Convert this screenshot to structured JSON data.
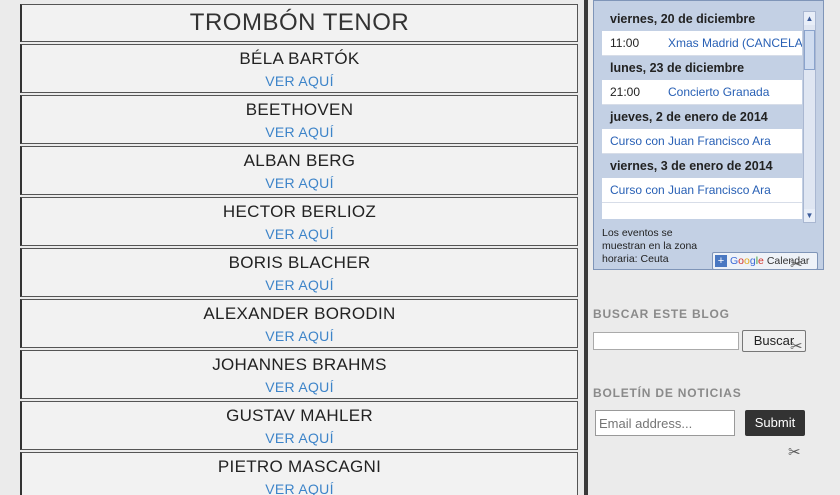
{
  "main": {
    "table_title": "TROMBÓN TENOR",
    "link_label": "VER AQUÍ",
    "composers": [
      "BÉLA BARTÓK",
      "BEETHOVEN",
      "ALBAN BERG",
      "HECTOR BERLIOZ",
      "BORIS BLACHER",
      "ALEXANDER BORODIN",
      "JOHANNES BRAHMS",
      "GUSTAV MAHLER",
      "PIETRO MASCAGNI"
    ]
  },
  "calendar": {
    "days": [
      {
        "date": "viernes, 20 de diciembre",
        "events": [
          {
            "time": "11:00",
            "title": "Xmas Madrid (CANCELADO)"
          }
        ]
      },
      {
        "date": "lunes, 23 de diciembre",
        "events": [
          {
            "time": "21:00",
            "title": "Concierto Granada"
          }
        ]
      },
      {
        "date": "jueves, 2 de enero de 2014",
        "events": [
          {
            "time": "",
            "title": "Curso con Juan Francisco Ara"
          }
        ]
      },
      {
        "date": "viernes, 3 de enero de 2014",
        "events": [
          {
            "time": "",
            "title": "Curso con Juan Francisco Ara"
          }
        ]
      }
    ],
    "timezone_note": "Los eventos se muestran en la zona horaria: Ceuta",
    "google_button": {
      "plus": "+",
      "brand": "Google",
      "suffix": "Calendar"
    }
  },
  "search": {
    "section_title": "BUSCAR ESTE BLOG",
    "button_label": "Buscar"
  },
  "newsletter": {
    "section_title": "BOLETÍN DE NOTICIAS",
    "email_placeholder": "Email address...",
    "submit_label": "Submit"
  }
}
